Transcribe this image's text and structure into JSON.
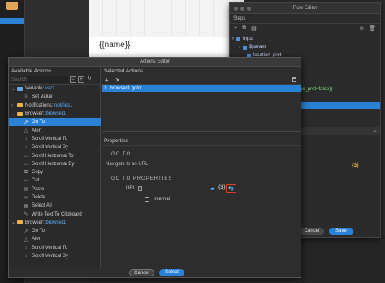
{
  "background": {
    "canvas_template": "{{name}}"
  },
  "flow_editor": {
    "title": "Flow Editor",
    "steps_label": "Steps",
    "tree": [
      {
        "label": "Input"
      },
      {
        "label": "$param"
      },
      {
        "label": "location_pret"
      }
    ],
    "side_text": "oc_pret=false)}",
    "var_token": "{$}",
    "cancel_label": "Cancel",
    "save_label": "Save"
  },
  "actions_editor": {
    "title": "Actions Editor",
    "available_title": "Available Actions",
    "search_placeholder": "Search",
    "actions": [
      {
        "kind": "header",
        "label": "Variable: ",
        "accent": "var1",
        "color": "#6aa7e0",
        "expanded": true
      },
      {
        "kind": "child",
        "label": "Set Value",
        "icon": "≡"
      },
      {
        "kind": "header",
        "label": "Notifications: ",
        "accent": "notifies1",
        "color": "#e8b34a",
        "expanded": false
      },
      {
        "kind": "header",
        "label": "Browser: ",
        "accent": "browser1",
        "color": "#e8b34a",
        "expanded": true
      },
      {
        "kind": "child",
        "label": "Go To",
        "icon": "↗",
        "selected": true
      },
      {
        "kind": "child",
        "label": "Alert",
        "icon": "△"
      },
      {
        "kind": "child",
        "label": "Scroll Vertical To",
        "icon": "↕"
      },
      {
        "kind": "child",
        "label": "Scroll Vertical By",
        "icon": "↕"
      },
      {
        "kind": "child",
        "label": "Scroll Horizontal To",
        "icon": "↔"
      },
      {
        "kind": "child",
        "label": "Scroll Horizontal By",
        "icon": "↔"
      },
      {
        "kind": "child",
        "label": "Copy",
        "icon": "⧉"
      },
      {
        "kind": "child",
        "label": "Cut",
        "icon": "✂"
      },
      {
        "kind": "child",
        "label": "Paste",
        "icon": "▤"
      },
      {
        "kind": "child",
        "label": "Delete",
        "icon": "✕"
      },
      {
        "kind": "child",
        "label": "Select All",
        "icon": "▦"
      },
      {
        "kind": "child",
        "label": "Write Text To Clipboard",
        "icon": "✎"
      },
      {
        "kind": "header",
        "label": "Browser: ",
        "accent": "browser1",
        "color": "#e8b34a",
        "expanded": true
      },
      {
        "kind": "child",
        "label": "Go To",
        "icon": "↗"
      },
      {
        "kind": "child",
        "label": "Alert",
        "icon": "△"
      },
      {
        "kind": "child",
        "label": "Scroll Vertical To",
        "icon": "↕"
      },
      {
        "kind": "child",
        "label": "Scroll Vertical By",
        "icon": "↕"
      }
    ],
    "selected_title": "Selected Actions",
    "add_icon": "+",
    "remove_icon": "✕",
    "selected_item": {
      "index": "1",
      "label": "browser1.goto"
    },
    "properties_title": "Properties",
    "goto_title": "GO TO",
    "goto_description": "Navigate to an URL",
    "goto_props_title": "GO TO PROPERTIES",
    "url_label": "URL",
    "dynamic_icon": "{$}",
    "internal_label": "Internal",
    "cancel_label": "Cancel",
    "select_label": "Select"
  }
}
